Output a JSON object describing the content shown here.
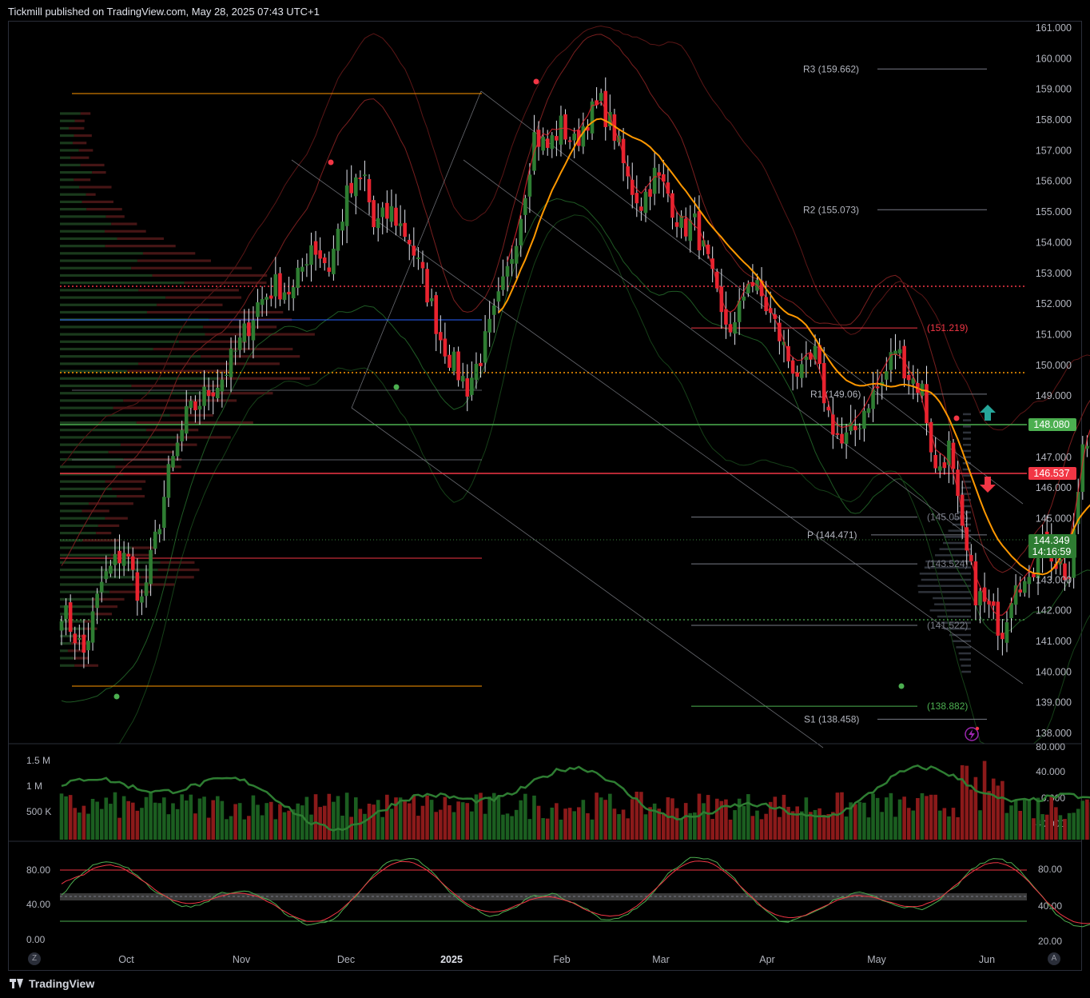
{
  "header": {
    "text": "Tickmill published on TradingView.com, May 28, 2025 07:43 UTC+1"
  },
  "footer": {
    "brand": "TradingView"
  },
  "corner_buttons": {
    "left": "Z",
    "right": "A"
  },
  "colors": {
    "bull": "#2e7d32",
    "bear": "#e8232f",
    "accent_green": "#4caf50",
    "accent_red": "#f23645",
    "ma_orange": "#ff9800",
    "level_gray": "#787b86"
  },
  "icons": {
    "up_arrow": "arrow-up-icon",
    "down_arrow": "arrow-down-icon",
    "alert": "lightning-icon"
  },
  "chart_data": [
    {
      "type": "candlestick",
      "x_ticks": [
        "Oct",
        "Nov",
        "Dec",
        "2025",
        "Feb",
        "Mar",
        "Apr",
        "May",
        "Jun"
      ],
      "y_ticks": [
        "161.000",
        "160.000",
        "159.000",
        "158.000",
        "157.000",
        "156.000",
        "155.000",
        "154.000",
        "153.000",
        "152.000",
        "151.000",
        "150.000",
        "149.000",
        "148.000",
        "147.000",
        "146.000",
        "145.000",
        "144.000",
        "143.000",
        "142.000",
        "141.000",
        "140.000",
        "139.000",
        "138.000"
      ],
      "ylim": [
        137.7,
        161.3
      ],
      "close_points": [
        [
          0,
          142.1
        ],
        [
          5,
          140.6
        ],
        [
          9,
          142.9
        ],
        [
          14,
          144.0
        ],
        [
          18,
          142.3
        ],
        [
          20,
          143.6
        ],
        [
          24,
          146.4
        ],
        [
          28,
          148.3
        ],
        [
          32,
          149.0
        ],
        [
          36,
          149.6
        ],
        [
          40,
          150.7
        ],
        [
          44,
          152.0
        ],
        [
          48,
          152.6
        ],
        [
          52,
          152.4
        ],
        [
          56,
          154.0
        ],
        [
          60,
          153.2
        ],
        [
          64,
          155.5
        ],
        [
          68,
          156.1
        ],
        [
          70,
          154.5
        ],
        [
          74,
          155.0
        ],
        [
          78,
          154.1
        ],
        [
          82,
          152.4
        ],
        [
          85,
          150.9
        ],
        [
          88,
          150.0
        ],
        [
          91,
          149.3
        ],
        [
          94,
          150.3
        ],
        [
          97,
          151.6
        ],
        [
          100,
          153.0
        ],
        [
          103,
          155.0
        ],
        [
          106,
          157.5
        ],
        [
          109,
          157.1
        ],
        [
          112,
          157.8
        ],
        [
          115,
          157.2
        ],
        [
          118,
          158.1
        ],
        [
          121,
          158.5
        ],
        [
          124,
          157.6
        ],
        [
          127,
          156.0
        ],
        [
          130,
          155.3
        ],
        [
          133,
          156.2
        ],
        [
          136,
          155.6
        ],
        [
          139,
          154.5
        ],
        [
          142,
          154.6
        ],
        [
          145,
          153.3
        ],
        [
          148,
          151.5
        ],
        [
          151,
          151.2
        ],
        [
          154,
          152.9
        ],
        [
          157,
          152.2
        ],
        [
          160,
          151.3
        ],
        [
          163,
          150.2
        ],
        [
          166,
          149.6
        ],
        [
          169,
          150.3
        ],
        [
          172,
          148.4
        ],
        [
          175,
          147.4
        ],
        [
          178,
          147.9
        ],
        [
          181,
          148.9
        ],
        [
          184,
          149.4
        ],
        [
          187,
          150.6
        ],
        [
          190,
          149.7
        ],
        [
          193,
          149.2
        ],
        [
          196,
          146.5
        ],
        [
          199,
          147.3
        ],
        [
          202,
          144.4
        ],
        [
          205,
          142.6
        ],
        [
          208,
          142.0
        ],
        [
          211,
          141.4
        ],
        [
          214,
          143.2
        ],
        [
          217,
          142.7
        ],
        [
          220,
          144.7
        ],
        [
          223,
          143.4
        ],
        [
          226,
          142.9
        ],
        [
          229,
          147.5
        ],
        [
          232,
          148.3
        ],
        [
          235,
          146.1
        ],
        [
          238,
          145.0
        ],
        [
          241,
          143.0
        ],
        [
          244,
          142.3
        ],
        [
          246,
          144.3
        ]
      ],
      "series": [
        {
          "name": "Price"
        },
        {
          "name": "MA"
        }
      ],
      "levels": [
        {
          "label": "R3 (159.662)",
          "value": 159.662
        },
        {
          "label": "R2 (155.073)",
          "value": 155.073
        },
        {
          "label": "(151.219)",
          "value": 151.219
        },
        {
          "label": "R1 (149.06)",
          "value": 149.06
        },
        {
          "label": "148.080",
          "value": 148.08
        },
        {
          "label": "146.537",
          "value": 146.537
        },
        {
          "label": "(145.050)",
          "value": 145.05
        },
        {
          "label": "P (144.471)",
          "value": 144.471
        },
        {
          "label": "(143.524)",
          "value": 143.524
        },
        {
          "label": "(141.522)",
          "value": 141.522
        },
        {
          "label": "(138.882)",
          "value": 138.882
        },
        {
          "label": "S1 (138.458)",
          "value": 138.458
        }
      ],
      "last_price": "144.349",
      "countdown": "14:16:59"
    },
    {
      "type": "bar",
      "name": "Volume",
      "y_ticks_left": [
        "1.5 M",
        "1 M",
        "500 K"
      ],
      "y_ticks_right": [
        "80.000",
        "40.000",
        "0.000",
        "-40.000"
      ]
    },
    {
      "type": "line",
      "name": "Stochastic",
      "y_ticks_left": [
        "80.00",
        "40.00",
        "0.00"
      ],
      "y_ticks_right": [
        "80.00",
        "40.00",
        "20.00"
      ]
    }
  ]
}
